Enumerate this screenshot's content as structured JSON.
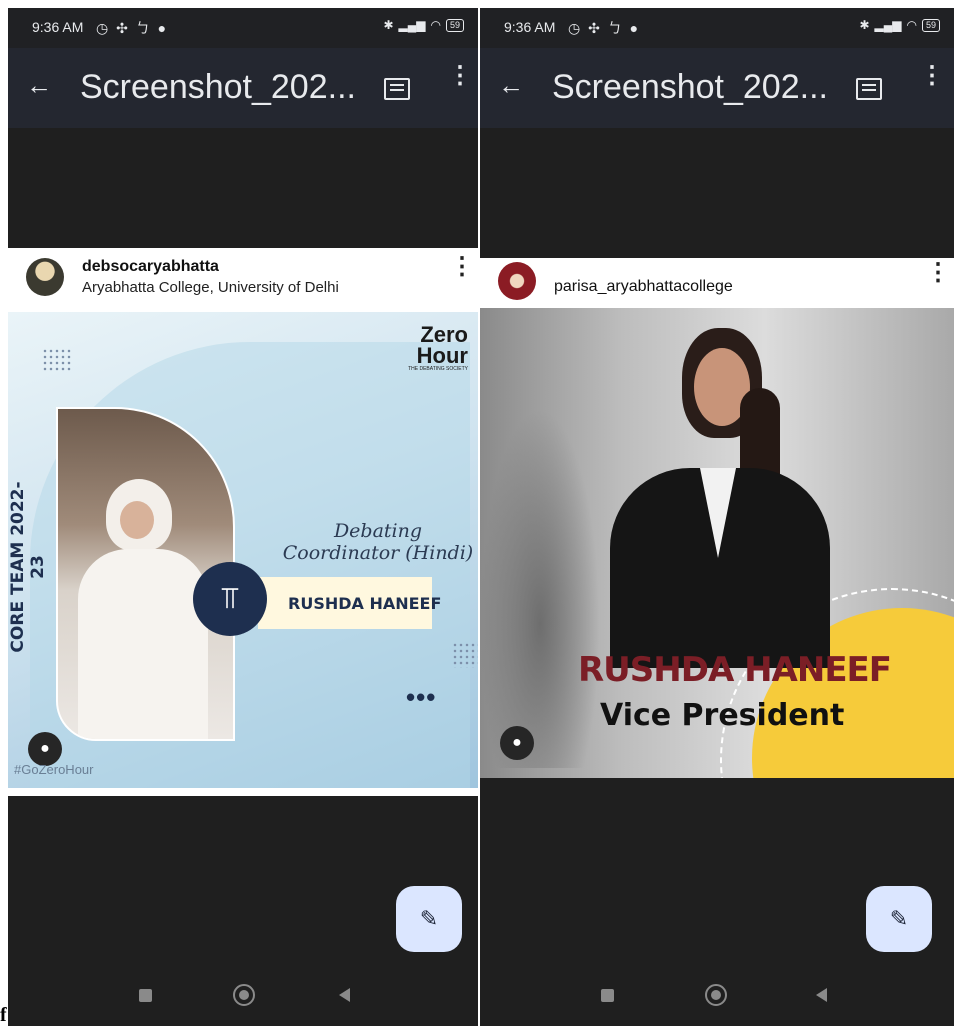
{
  "left": {
    "status": {
      "time": "9:36 AM",
      "battery": "59"
    },
    "appbar": {
      "title": "Screenshot_202..."
    },
    "post": {
      "username": "debsocaryabhatta",
      "location": "Aryabhatta College, University of Delhi",
      "graphic": {
        "logo_line1": "Zero",
        "logo_line2": "Hour",
        "logo_sub": "THE DEBATING SOCIETY",
        "side_text": "CORE TEAM 2022-23",
        "role": "Debating Coordinator (Hindi)",
        "name": "RUSHDA HANEEF",
        "hashtag": "#GoZeroHour"
      }
    }
  },
  "right": {
    "status": {
      "time": "9:36 AM",
      "battery": "59"
    },
    "appbar": {
      "title": "Screenshot_202..."
    },
    "post": {
      "username": "parisa_aryabhattacollege",
      "graphic": {
        "name": "RUSHDA HANEEF",
        "role": "Vice President"
      }
    }
  },
  "stray_letter": "f",
  "colors": {
    "status_bg": "#202124",
    "appbar_bg": "#242730",
    "viewer_bg": "#1f1f1f",
    "fab_bg": "#dbe6ff",
    "accent_yellow": "#f6cb3a",
    "name_maroon": "#7b1e26",
    "navy": "#1e2f4f"
  }
}
